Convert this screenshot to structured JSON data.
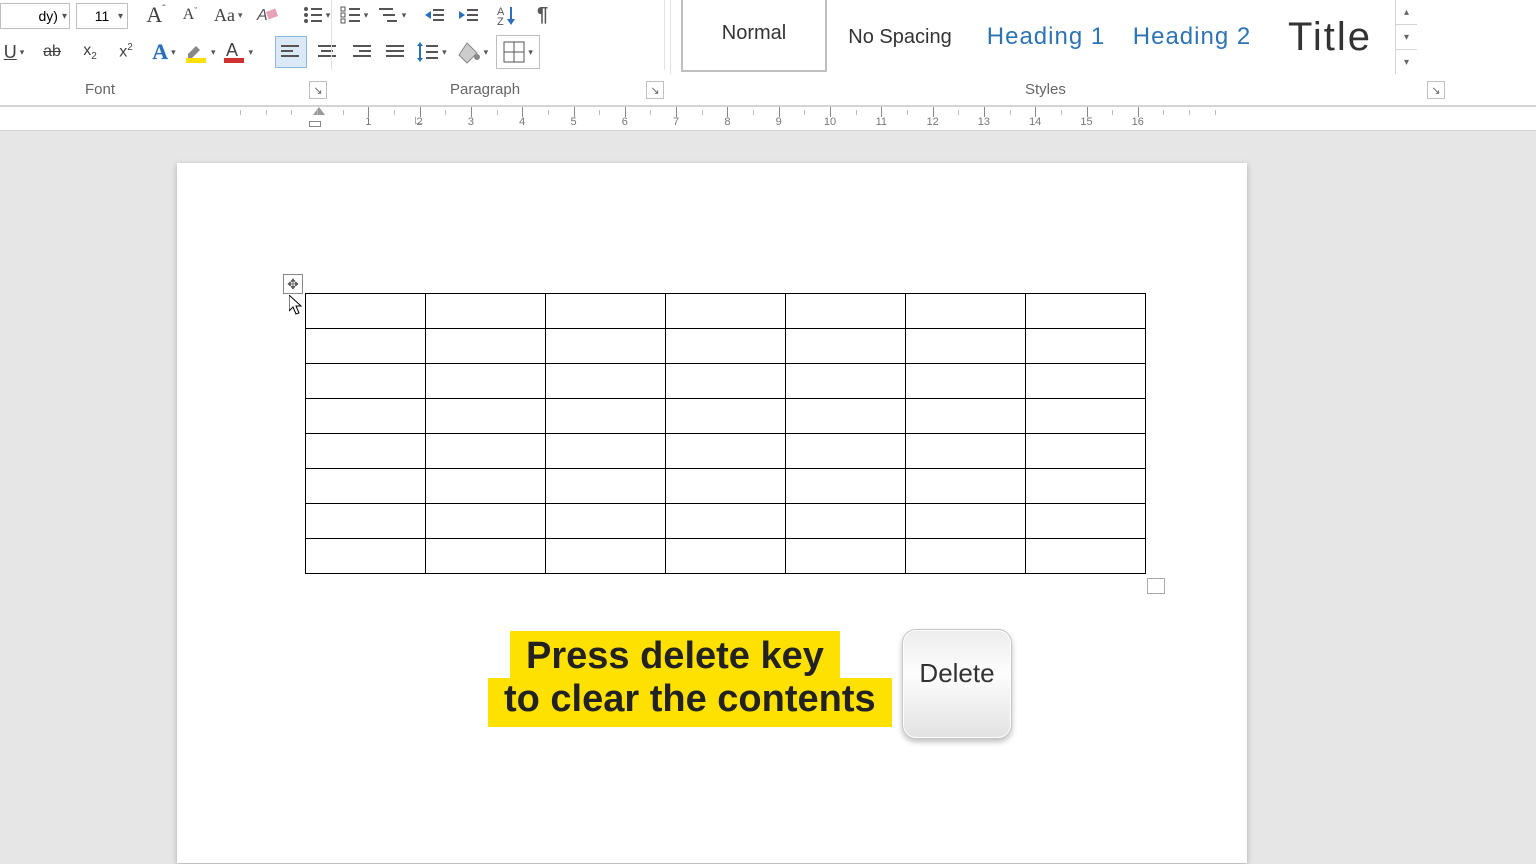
{
  "ribbon": {
    "font_name_tail": "dy)",
    "font_size": "11",
    "groups": {
      "font": "Font",
      "paragraph": "Paragraph",
      "styles": "Styles"
    }
  },
  "styles_gallery": {
    "items": [
      {
        "label": "Normal"
      },
      {
        "label": "No Spacing"
      },
      {
        "label": "Heading 1"
      },
      {
        "label": "Heading 2"
      },
      {
        "label": "Title"
      }
    ]
  },
  "ruler": {
    "numbers": [
      1,
      2,
      3,
      4,
      5,
      6,
      7,
      8,
      9,
      10,
      11,
      12,
      13,
      14,
      15,
      16
    ]
  },
  "document": {
    "table": {
      "rows": 8,
      "cols": 7
    }
  },
  "annotation": {
    "line1": "Press delete key",
    "line2": "to clear the contents",
    "key_label": "Delete"
  }
}
